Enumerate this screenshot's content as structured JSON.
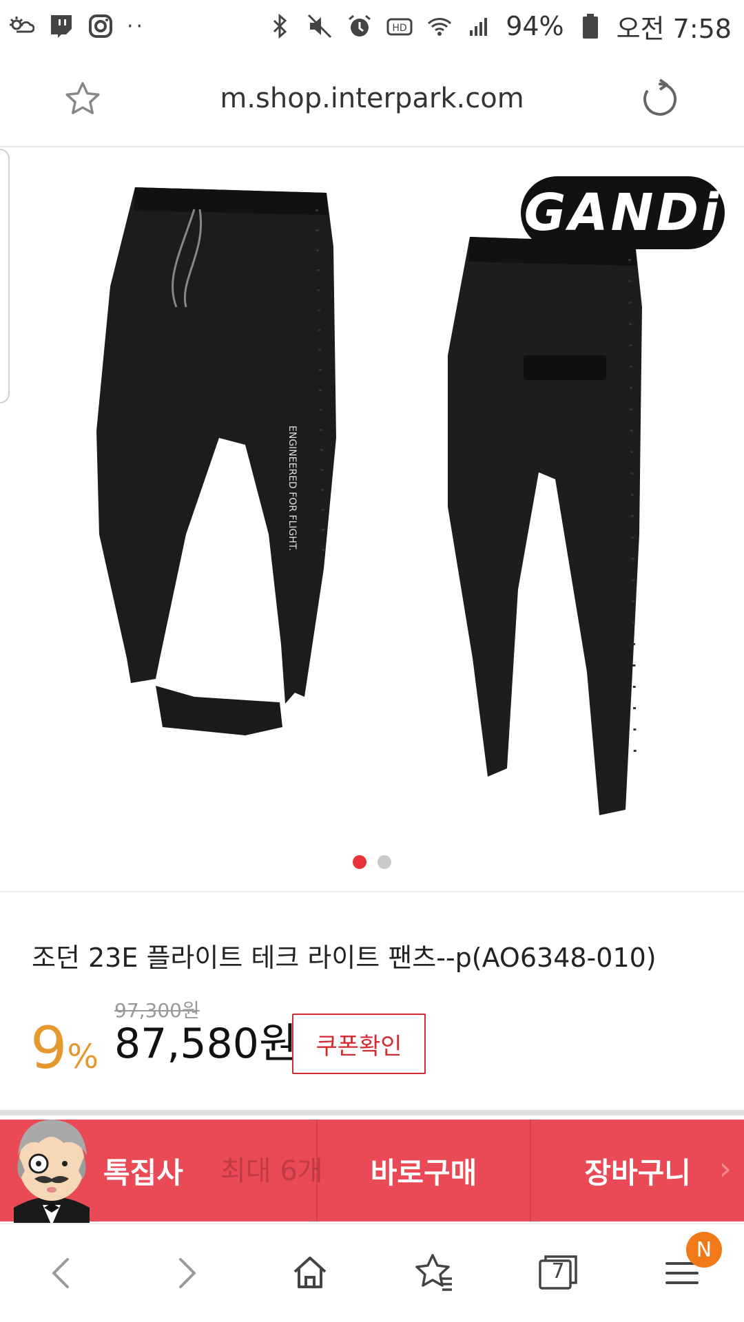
{
  "status_bar": {
    "battery": "94%",
    "time": "오전 7:58",
    "hd_label": "HD",
    "more": "··",
    "icons_left": [
      "weather-icon",
      "twitch-icon",
      "instagram-icon"
    ],
    "icons_right": [
      "bluetooth-icon",
      "mute-icon",
      "alarm-icon",
      "hd-icon",
      "wifi-icon",
      "signal-icon",
      "battery-icon"
    ]
  },
  "browser": {
    "url": "m.shop.interpark.com",
    "icons": [
      "star-icon",
      "reload-icon"
    ]
  },
  "product": {
    "brand_logo": "GANDi",
    "carousel": {
      "count": 2,
      "active": 0
    },
    "title": "조던 23E 플라이트 테크 라이트 팬츠--p(AO6348-010)",
    "original_price": "97,300원",
    "discount_value": "9",
    "discount_unit": "%",
    "sale_price": "87,580원",
    "coupon_label": "쿠폰확인"
  },
  "action_bar": {
    "talk_label": "톡집사",
    "buy_label": "바로구매",
    "cart_label": "장바구니",
    "ghost_text": "최대 6개"
  },
  "bottom_nav": {
    "tab_count": "7",
    "badge": "N",
    "icons": [
      "back-icon",
      "forward-icon",
      "home-icon",
      "bookmark-icon",
      "tabs-icon",
      "menu-icon"
    ]
  },
  "colors": {
    "accent_red": "#ea4a55",
    "discount_orange": "#e5982d",
    "coupon_red": "#d32b32",
    "badge_orange": "#f07a17"
  }
}
